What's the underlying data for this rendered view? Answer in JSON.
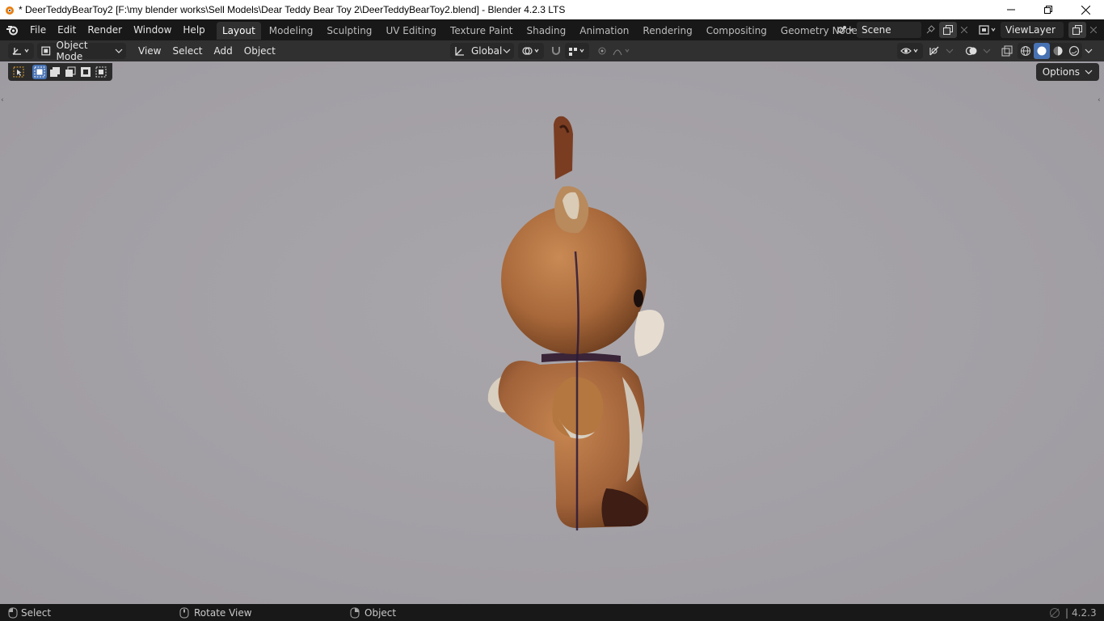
{
  "window": {
    "title": "* DeerTeddyBearToy2 [F:\\my blender works\\Sell Models\\Dear Teddy Bear Toy 2\\DeerTeddyBearToy2.blend] - Blender 4.2.3 LTS"
  },
  "menus": [
    "File",
    "Edit",
    "Render",
    "Window",
    "Help"
  ],
  "workspaces": [
    "Layout",
    "Modeling",
    "Sculpting",
    "UV Editing",
    "Texture Paint",
    "Shading",
    "Animation",
    "Rendering",
    "Compositing",
    "Geometry Nodes"
  ],
  "active_workspace": "Layout",
  "scene": {
    "name": "Scene"
  },
  "view_layer": {
    "name": "ViewLayer"
  },
  "viewport_header": {
    "mode": "Object Mode",
    "menus": [
      "View",
      "Select",
      "Add",
      "Object"
    ],
    "transform_orientation": "Global"
  },
  "viewport": {
    "options_label": "Options"
  },
  "statusbar": {
    "select": "Select",
    "rotate": "Rotate View",
    "object": "Object",
    "version": "4.2.3"
  },
  "colors": {
    "accent": "#4772b3",
    "viewport_bg": "#a29fa5",
    "header_bg": "#303030",
    "topbar_bg": "#181818"
  }
}
